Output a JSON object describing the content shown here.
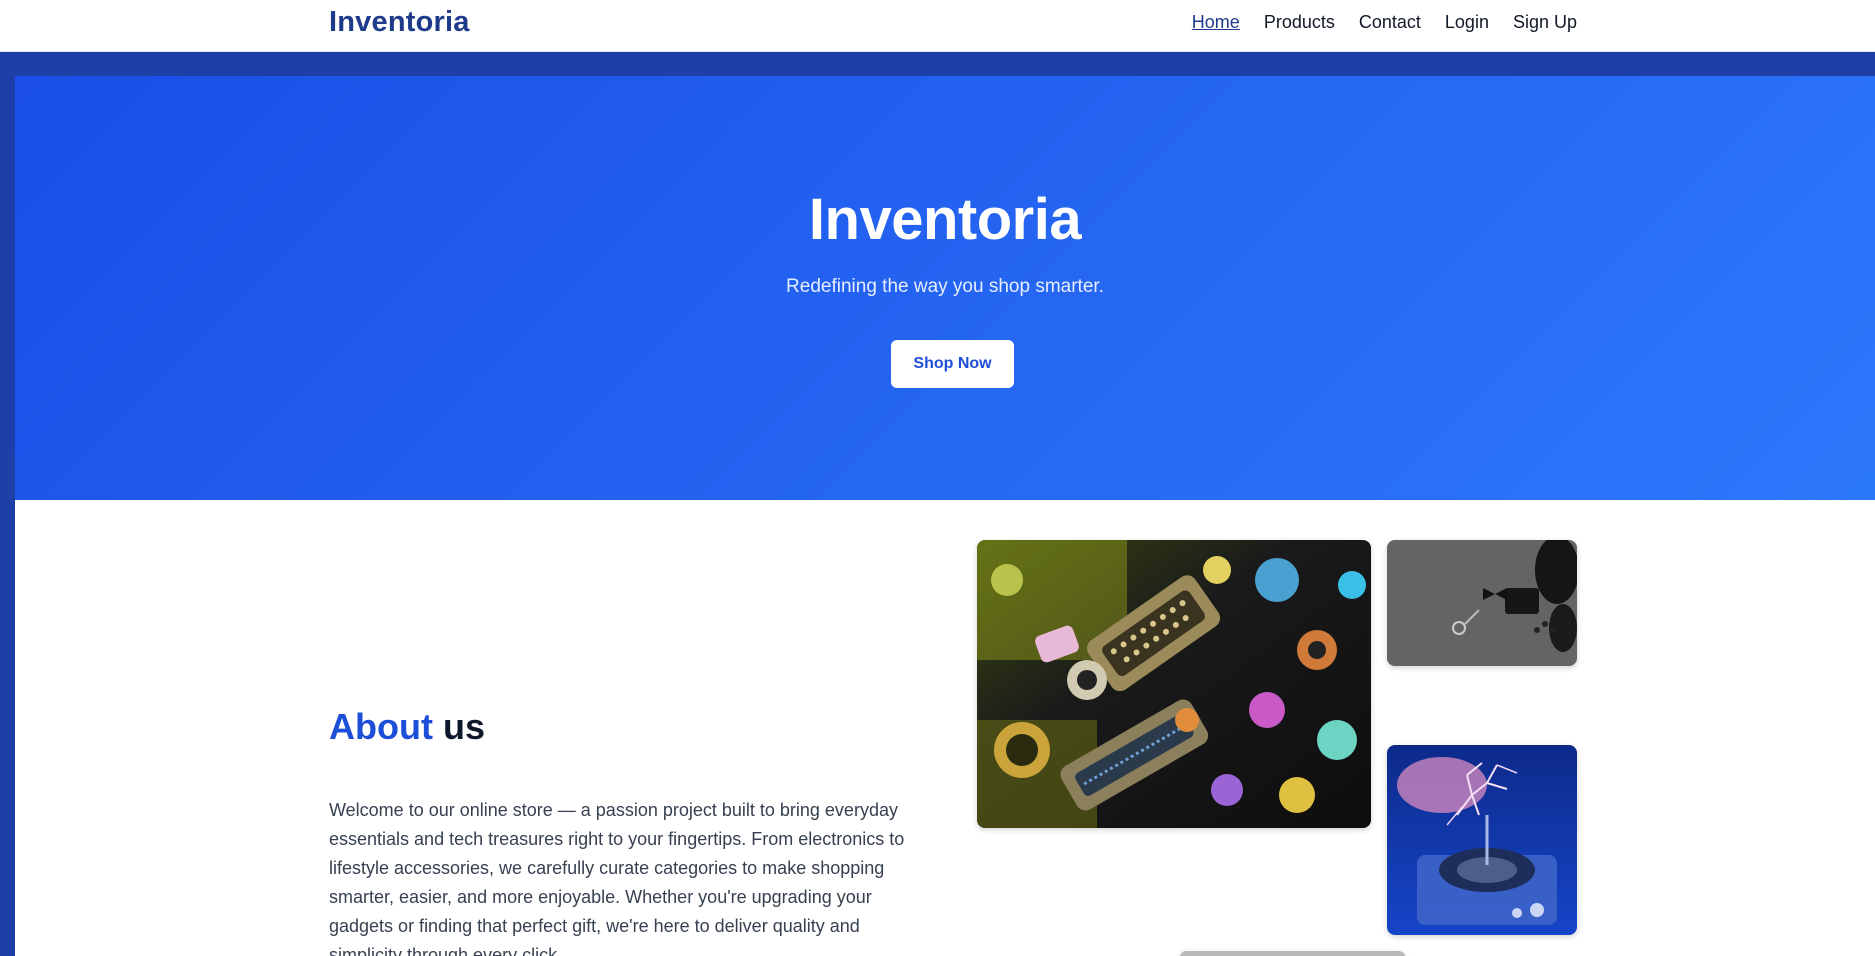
{
  "navbar": {
    "brand": "Inventoria",
    "links": [
      {
        "label": "Home",
        "active": true
      },
      {
        "label": "Products",
        "active": false
      },
      {
        "label": "Contact",
        "active": false
      },
      {
        "label": "Login",
        "active": false
      },
      {
        "label": "Sign Up",
        "active": false
      }
    ]
  },
  "hero": {
    "title": "Inventoria",
    "subtitle": "Redefining the way you shop smarter.",
    "cta_label": "Shop Now"
  },
  "about": {
    "heading_accent": "About",
    "heading_rest": "us",
    "text": "Welcome to our online store — a passion project built to bring everyday essentials and tech treasures right to your fingertips. From electronics to lifestyle accessories, we carefully curate categories to make shopping smarter, easier, and more enjoyable. Whether you're upgrading your gadgets or finding that perfect gift, we're here to deliver quality and simplicity through every click."
  },
  "colors": {
    "brand": "#1e3a8a",
    "accent": "#1d4ed8",
    "hero_gradient_start": "#1a4ee6",
    "hero_gradient_end": "#2c78fb"
  },
  "images": [
    {
      "name": "electronic-connectors-photo"
    },
    {
      "name": "mens-accessories-photo"
    },
    {
      "name": "tesla-coil-photo"
    }
  ]
}
